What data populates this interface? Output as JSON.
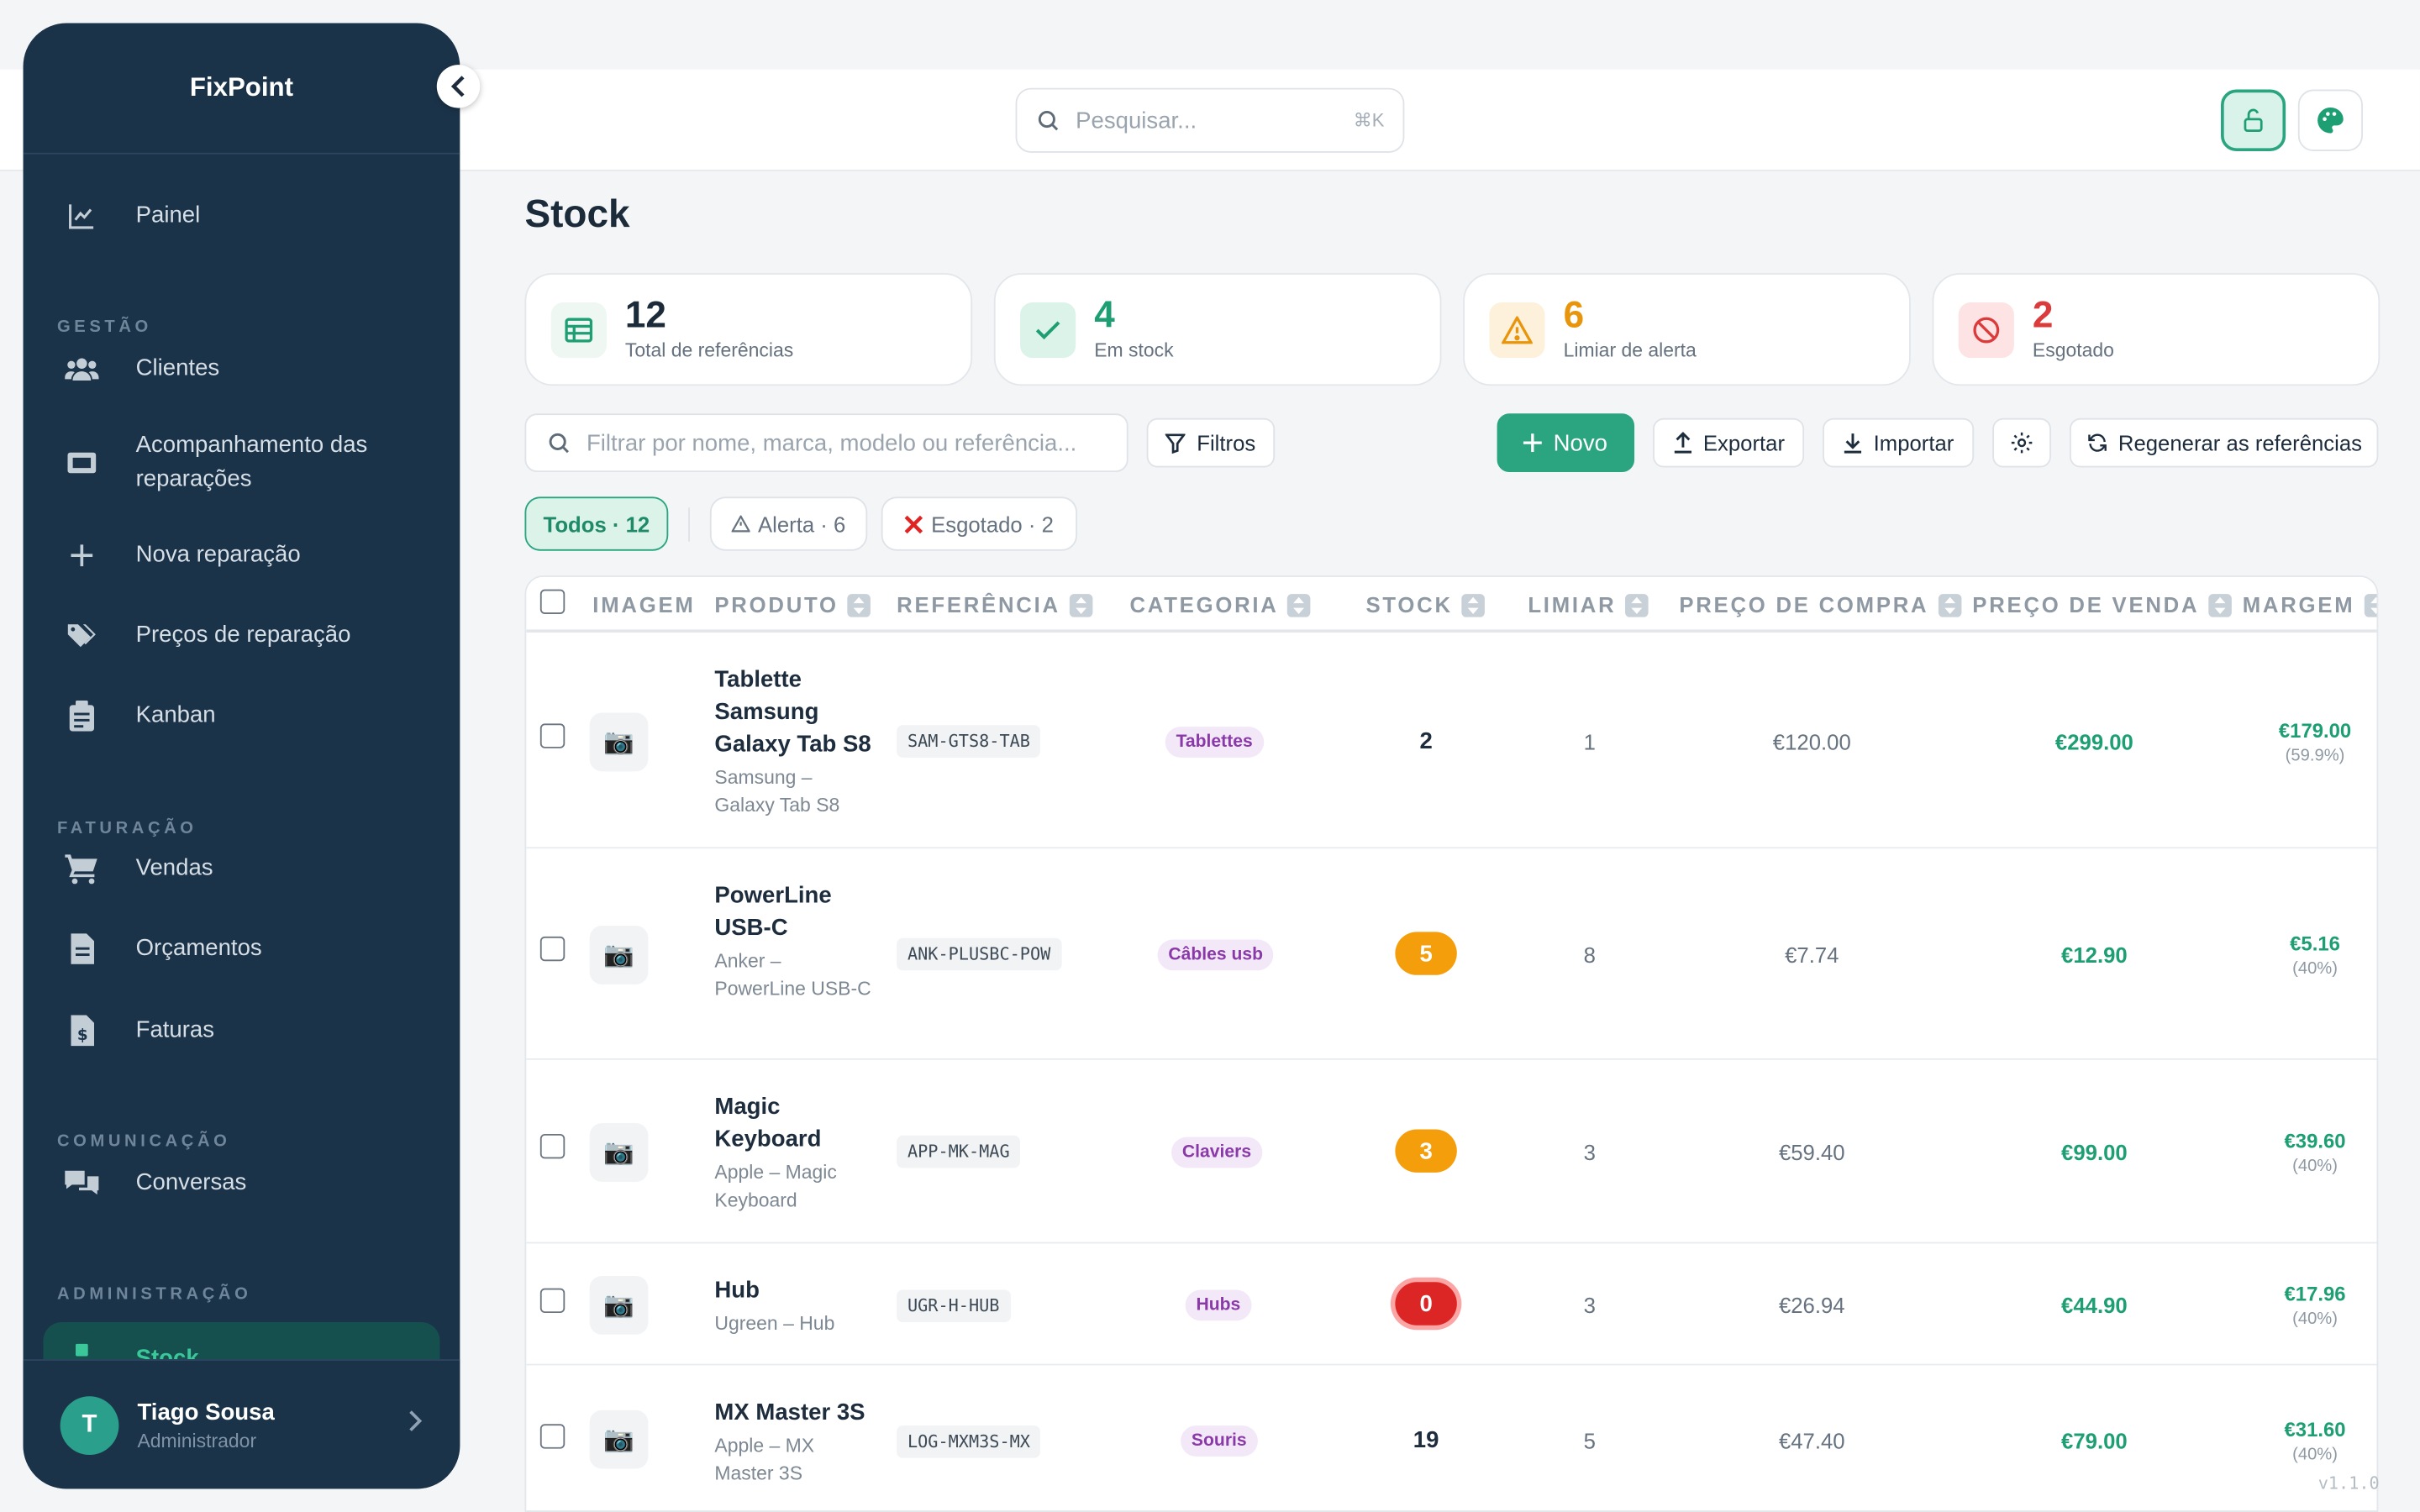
{
  "app": {
    "name": "FixPoint",
    "version": "v1.1.0"
  },
  "header": {
    "search_placeholder": "Pesquisar...",
    "search_shortcut": "⌘K"
  },
  "sidebar": {
    "top_item": {
      "label": "Painel",
      "icon": "chart-line-icon"
    },
    "sections": [
      {
        "title": "GESTÃO",
        "items": [
          {
            "label": "Clientes",
            "icon": "users-icon"
          },
          {
            "label": "Acompanhamento das reparações",
            "icon": "tracking-icon"
          },
          {
            "label": "Nova reparação",
            "icon": "plus-icon"
          },
          {
            "label": "Preços de reparação",
            "icon": "tags-icon"
          },
          {
            "label": "Kanban",
            "icon": "clipboard-icon"
          }
        ]
      },
      {
        "title": "FATURAÇÃO",
        "items": [
          {
            "label": "Vendas",
            "icon": "cart-icon"
          },
          {
            "label": "Orçamentos",
            "icon": "file-icon"
          },
          {
            "label": "Faturas",
            "icon": "invoice-icon"
          }
        ]
      },
      {
        "title": "COMUNICAÇÃO",
        "items": [
          {
            "label": "Conversas",
            "icon": "chat-icon"
          }
        ]
      },
      {
        "title": "ADMINISTRAÇÃO",
        "items": [
          {
            "label": "Stock",
            "icon": "boxes-icon",
            "active": true
          }
        ]
      }
    ],
    "user": {
      "initial": "T",
      "name": "Tiago Sousa",
      "role": "Administrador"
    }
  },
  "page": {
    "title": "Stock"
  },
  "stats": [
    {
      "value": "12",
      "label": "Total de referências",
      "color": "#1b2b3a",
      "icon": "table-icon"
    },
    {
      "value": "4",
      "label": "Em stock",
      "color": "#1e9e73",
      "icon": "check-icon"
    },
    {
      "value": "6",
      "label": "Limiar de alerta",
      "color": "#e8950c",
      "icon": "warning-icon"
    },
    {
      "value": "2",
      "label": "Esgotado",
      "color": "#dc3b3b",
      "icon": "ban-icon"
    }
  ],
  "toolbar": {
    "filter_placeholder": "Filtrar por nome, marca, modelo ou referência...",
    "filters_label": "Filtros",
    "new_label": "Novo",
    "export_label": "Exportar",
    "import_label": "Importar",
    "regen_label": "Regenerar as referências"
  },
  "chips": {
    "all": "Todos · 12",
    "alert": "Alerta · 6",
    "out": "Esgotado · 2"
  },
  "table": {
    "columns": [
      "IMAGEM",
      "PRODUTO",
      "REFERÊNCIA",
      "CATEGORIA",
      "STOCK",
      "LIMIAR",
      "PREÇO DE COMPRA",
      "PREÇO DE VENDA",
      "MARGEM"
    ],
    "rows": [
      {
        "name": "Tablette Samsung Galaxy Tab S8",
        "sub": "Samsung – Galaxy Tab S8",
        "ref": "SAM-GTS8-TAB",
        "category": "Tablettes",
        "stock": "2",
        "stock_state": "normal",
        "threshold": "1",
        "buy": "€120.00",
        "sell": "€299.00",
        "margin": "€179.00",
        "margin_pct": "(59.9%)"
      },
      {
        "name": "PowerLine USB-C",
        "sub": "Anker – PowerLine USB-C",
        "ref": "ANK-PLUSBC-POW",
        "category": "Câbles usb",
        "stock": "5",
        "stock_state": "warn",
        "threshold": "8",
        "buy": "€7.74",
        "sell": "€12.90",
        "margin": "€5.16",
        "margin_pct": "(40%)"
      },
      {
        "name": "Magic Keyboard",
        "sub": "Apple – Magic Keyboard",
        "ref": "APP-MK-MAG",
        "category": "Claviers",
        "stock": "3",
        "stock_state": "warn",
        "threshold": "3",
        "buy": "€59.40",
        "sell": "€99.00",
        "margin": "€39.60",
        "margin_pct": "(40%)"
      },
      {
        "name": "Hub",
        "sub": "Ugreen – Hub",
        "ref": "UGR-H-HUB",
        "category": "Hubs",
        "stock": "0",
        "stock_state": "out",
        "threshold": "3",
        "buy": "€26.94",
        "sell": "€44.90",
        "margin": "€17.96",
        "margin_pct": "(40%)"
      },
      {
        "name": "MX Master 3S",
        "sub": "Apple – MX Master 3S",
        "ref": "LOG-MXM3S-MX",
        "category": "Souris",
        "stock": "19",
        "stock_state": "normal",
        "threshold": "5",
        "buy": "€47.40",
        "sell": "€79.00",
        "margin": "€31.60",
        "margin_pct": "(40%)"
      }
    ]
  }
}
